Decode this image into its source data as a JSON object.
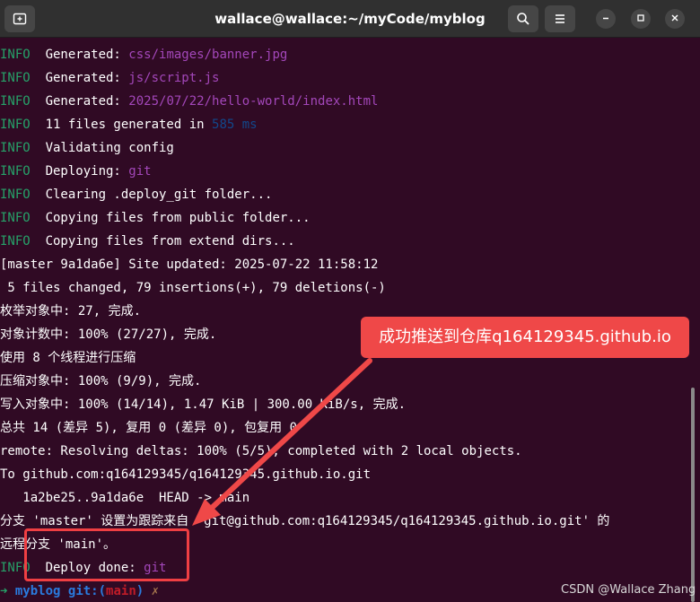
{
  "window": {
    "title": "wallace@wallace:~/myCode/myblog"
  },
  "titlebar": {
    "new_tab_icon": "new-tab-icon",
    "search_icon": "search-icon",
    "menu_icon": "hamburger-menu-icon",
    "minimize_icon": "minimize-icon",
    "maximize_icon": "maximize-icon",
    "close_icon": "close-icon"
  },
  "terminal": {
    "lines": [
      {
        "tag": "INFO",
        "pre": "  Generated: ",
        "hi": "css/images/banner.jpg",
        "post": ""
      },
      {
        "tag": "INFO",
        "pre": "  Generated: ",
        "hi": "js/script.js",
        "post": ""
      },
      {
        "tag": "INFO",
        "pre": "  Generated: ",
        "hi": "2025/07/22/hello-world/index.html",
        "post": ""
      },
      {
        "tag": "INFO",
        "pre": "  11 files generated in ",
        "hi": "585 ms",
        "post": ""
      },
      {
        "tag": "INFO",
        "pre": "  Validating config",
        "hi": "",
        "post": ""
      },
      {
        "tag": "INFO",
        "pre": "  Deploying: ",
        "hi": "git",
        "post": ""
      },
      {
        "tag": "INFO",
        "pre": "  Clearing .deploy_git folder...",
        "hi": "",
        "post": ""
      },
      {
        "tag": "INFO",
        "pre": "  Copying files from public folder...",
        "hi": "",
        "post": ""
      },
      {
        "tag": "INFO",
        "pre": "  Copying files from extend dirs...",
        "hi": "",
        "post": ""
      }
    ],
    "plain": [
      "[master 9a1da6e] Site updated: 2025-07-22 11:58:12",
      " 5 files changed, 79 insertions(+), 79 deletions(-)",
      "枚举对象中: 27, 完成.",
      "对象计数中: 100% (27/27), 完成.",
      "使用 8 个线程进行压缩",
      "压缩对象中: 100% (9/9), 完成.",
      "写入对象中: 100% (14/14), 1.47 KiB | 300.00 KiB/s, 完成.",
      "总共 14 (差异 5), 复用 0 (差异 0), 包复用 0",
      "remote: Resolving deltas: 100% (5/5), completed with 2 local objects.",
      "To github.com:q164129345/q164129345.github.io.git",
      "   1a2be25..9a1da6e  HEAD -> main",
      "分支 'master' 设置为跟踪来自 'git@github.com:q164129345/q164129345.github.io.git' 的",
      "远程分支 'main'。"
    ],
    "final": {
      "tag": "INFO",
      "pre": "  Deploy done: ",
      "hi": "git"
    },
    "prompt": {
      "arrow": "➜",
      "dir": "myblog",
      "git": "git:(",
      "branch": "main",
      "close": ")",
      "dirty": "✗"
    }
  },
  "annotation": {
    "callout_text": "成功推送到仓库q164129345.github.io",
    "color": "#ef4848"
  },
  "watermark": "CSDN @Wallace Zhang",
  "colors": {
    "background": "#300a24",
    "info": "#26a269",
    "magenta": "#a347ba",
    "blue": "#12488b",
    "annotation_red": "#ef3f43"
  }
}
